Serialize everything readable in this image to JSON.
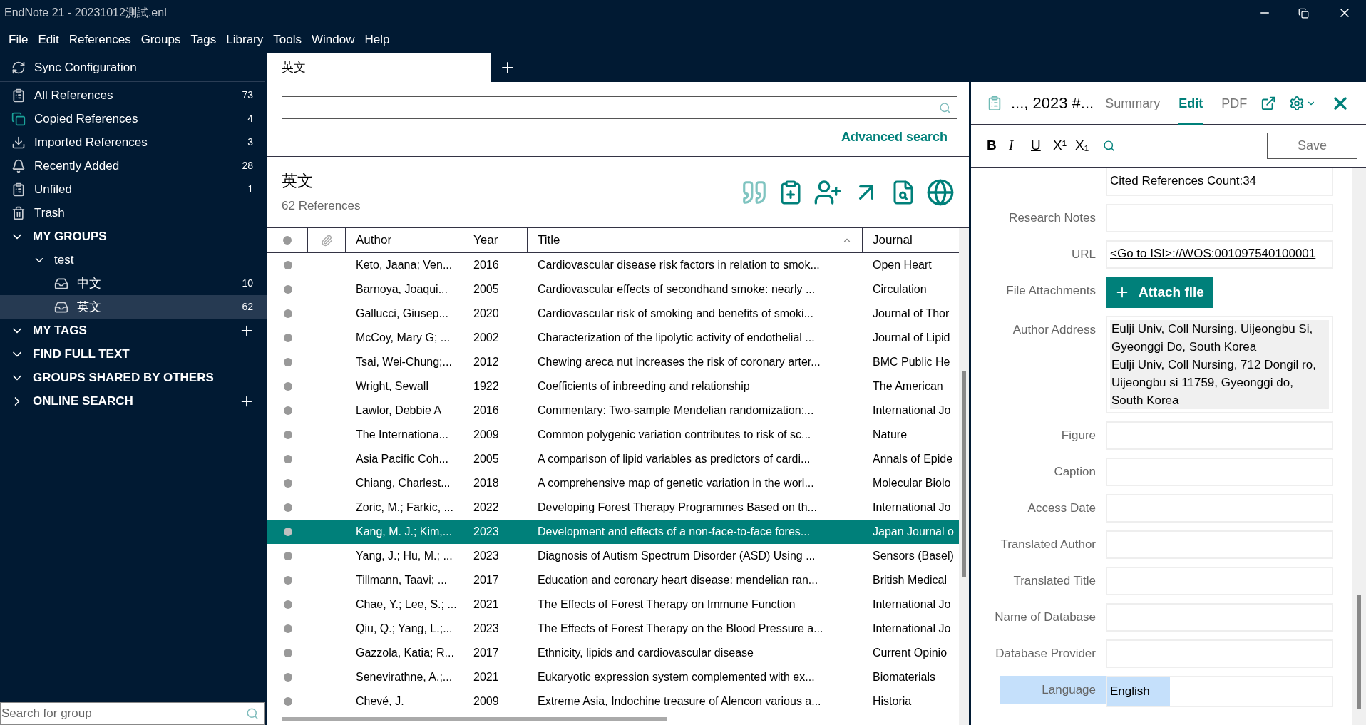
{
  "window": {
    "title": "EndNote 21 - 20231012測試.enl"
  },
  "menu": [
    "File",
    "Edit",
    "References",
    "Groups",
    "Tags",
    "Library",
    "Tools",
    "Window",
    "Help"
  ],
  "sidebar": {
    "sync": "Sync Configuration",
    "items": [
      {
        "kind": "all",
        "label": "All References",
        "count": "73",
        "selected": false
      },
      {
        "kind": "copied",
        "label": "Copied References",
        "count": "4",
        "selected": false
      },
      {
        "kind": "imported",
        "label": "Imported References",
        "count": "3",
        "selected": false
      },
      {
        "kind": "recent",
        "label": "Recently Added",
        "count": "28",
        "selected": false
      },
      {
        "kind": "unfiled",
        "label": "Unfiled",
        "count": "1",
        "selected": false
      },
      {
        "kind": "trash",
        "label": "Trash",
        "selected": false
      }
    ],
    "sections": [
      {
        "label": "MY GROUPS",
        "expanded": true,
        "addable": false,
        "children": [
          {
            "label": "test",
            "expanded": true,
            "children": [
              {
                "label": "中文",
                "count": "10",
                "selected": false
              },
              {
                "label": "英文",
                "count": "62",
                "selected": true
              }
            ]
          }
        ]
      },
      {
        "label": "MY TAGS",
        "expanded": true,
        "addable": true
      },
      {
        "label": "FIND FULL TEXT",
        "expanded": true,
        "addable": false
      },
      {
        "label": "GROUPS SHARED BY OTHERS",
        "expanded": true,
        "addable": false
      },
      {
        "label": "ONLINE SEARCH",
        "expanded": false,
        "addable": true
      }
    ],
    "group_search": {
      "placeholder": "Search for group"
    }
  },
  "library_tabs": [
    {
      "label": "英文",
      "selected": true
    }
  ],
  "search": {
    "advanced": "Advanced search"
  },
  "group_header": {
    "title": "英文",
    "count": "62 References"
  },
  "table": {
    "columns": [
      {
        "label": "Author",
        "sorted": false
      },
      {
        "label": "Year",
        "sorted": false
      },
      {
        "label": "Title",
        "sorted": true
      },
      {
        "label": "Journal",
        "sorted": false
      }
    ],
    "rows": [
      {
        "author": "Keto, Jaana; Ven...",
        "year": "2016",
        "title": "Cardiovascular disease risk factors in relation to smok...",
        "journal": "Open Heart",
        "selected": false
      },
      {
        "author": "Barnoya, Joaqui...",
        "year": "2005",
        "title": "Cardiovascular effects of secondhand smoke: nearly ...",
        "journal": "Circulation",
        "selected": false
      },
      {
        "author": "Gallucci, Giusep...",
        "year": "2020",
        "title": "Cardiovascular risk of smoking and benefits of smoki...",
        "journal": "Journal of Thor",
        "selected": false
      },
      {
        "author": "McCoy, Mary G; ...",
        "year": "2002",
        "title": "Characterization of the lipolytic activity of endothelial ...",
        "journal": "Journal of Lipid",
        "selected": false
      },
      {
        "author": "Tsai, Wei-Chung;...",
        "year": "2012",
        "title": "Chewing areca nut increases the risk of coronary arter...",
        "journal": "BMC Public He",
        "selected": false
      },
      {
        "author": "Wright, Sewall",
        "year": "1922",
        "title": "Coefficients of inbreeding and relationship",
        "journal": "The American",
        "selected": false
      },
      {
        "author": "Lawlor, Debbie A",
        "year": "2016",
        "title": "Commentary: Two-sample Mendelian randomization:...",
        "journal": "International Jo",
        "selected": false
      },
      {
        "author": "The Internationa...",
        "year": "2009",
        "title": "Common polygenic variation contributes to risk of sc...",
        "journal": "Nature",
        "selected": false
      },
      {
        "author": "Asia Pacific Coh...",
        "year": "2005",
        "title": "A comparison of lipid variables as predictors of cardi...",
        "journal": "Annals of Epide",
        "selected": false
      },
      {
        "author": "Chiang, Charlest...",
        "year": "2018",
        "title": "A comprehensive map of genetic variation in the worl...",
        "journal": "Molecular Biolo",
        "selected": false
      },
      {
        "author": "Zoric, M.; Farkic, ...",
        "year": "2022",
        "title": "Developing Forest Therapy Programmes Based on th...",
        "journal": "International Jo",
        "selected": false
      },
      {
        "author": "Kang, M. J.; Kim,...",
        "year": "2023",
        "title": "Development and effects of a non-face-to-face fores...",
        "journal": "Japan Journal o",
        "selected": true
      },
      {
        "author": "Yang, J.; Hu, M.; ...",
        "year": "2023",
        "title": "Diagnosis of Autism Spectrum Disorder (ASD) Using ...",
        "journal": "Sensors (Basel)",
        "selected": false
      },
      {
        "author": "Tillmann, Taavi; ...",
        "year": "2017",
        "title": "Education and coronary heart disease: mendelian ran...",
        "journal": "British Medical",
        "selected": false
      },
      {
        "author": "Chae, Y.; Lee, S.; ...",
        "year": "2021",
        "title": "The Effects of Forest Therapy on Immune Function",
        "journal": "International Jo",
        "selected": false
      },
      {
        "author": "Qiu, Q.; Yang, L.;...",
        "year": "2023",
        "title": "The Effects of Forest Therapy on the Blood Pressure a...",
        "journal": "International Jo",
        "selected": false
      },
      {
        "author": "Gazzola, Katia; R...",
        "year": "2017",
        "title": "Ethnicity, lipids and cardiovascular disease",
        "journal": "Current Opinio",
        "selected": false
      },
      {
        "author": "Senevirathne, A.;...",
        "year": "2021",
        "title": "Eukaryotic expression system complemented with ex...",
        "journal": "Biomaterials",
        "selected": false
      },
      {
        "author": "Chevé, J.",
        "year": "2009",
        "title": "Extreme Asia, Indochine treasure of Alencon various a...",
        "journal": "Historia",
        "selected": false
      }
    ]
  },
  "reference_panel": {
    "title": "..., 2023 #...",
    "tabs": [
      {
        "label": "Summary",
        "selected": false
      },
      {
        "label": "Edit",
        "selected": true
      },
      {
        "label": "PDF",
        "selected": false
      }
    ],
    "format_buttons": [
      "B",
      "I",
      "U",
      "X¹",
      "X₁"
    ],
    "save": "Save",
    "fields": [
      {
        "kind": "text",
        "value": "Cited References Count:34"
      },
      {
        "kind": "text",
        "label": "Research Notes"
      },
      {
        "kind": "link",
        "label": "URL",
        "value": "<Go to ISI>://WOS:001097540100001"
      },
      {
        "kind": "button",
        "label": "File Attachments",
        "value": "Attach file"
      },
      {
        "kind": "address",
        "label": "Author Address",
        "value": "Eulji Univ, Coll Nursing, Uijeongbu Si, Gyeonggi Do, South Korea\nEulji Univ, Coll Nursing, 712 Dongil ro, Uijeongbu si 11759, Gyeonggi do, South Korea"
      },
      {
        "kind": "text",
        "label": "Figure"
      },
      {
        "kind": "text",
        "label": "Caption"
      },
      {
        "kind": "text",
        "label": "Access Date"
      },
      {
        "kind": "text",
        "label": "Translated Author"
      },
      {
        "kind": "text",
        "label": "Translated Title"
      },
      {
        "kind": "text",
        "label": "Name of Database"
      },
      {
        "kind": "text",
        "label": "Database Provider"
      },
      {
        "kind": "text",
        "label": "Language",
        "value": "English",
        "highlighted": true
      }
    ]
  }
}
